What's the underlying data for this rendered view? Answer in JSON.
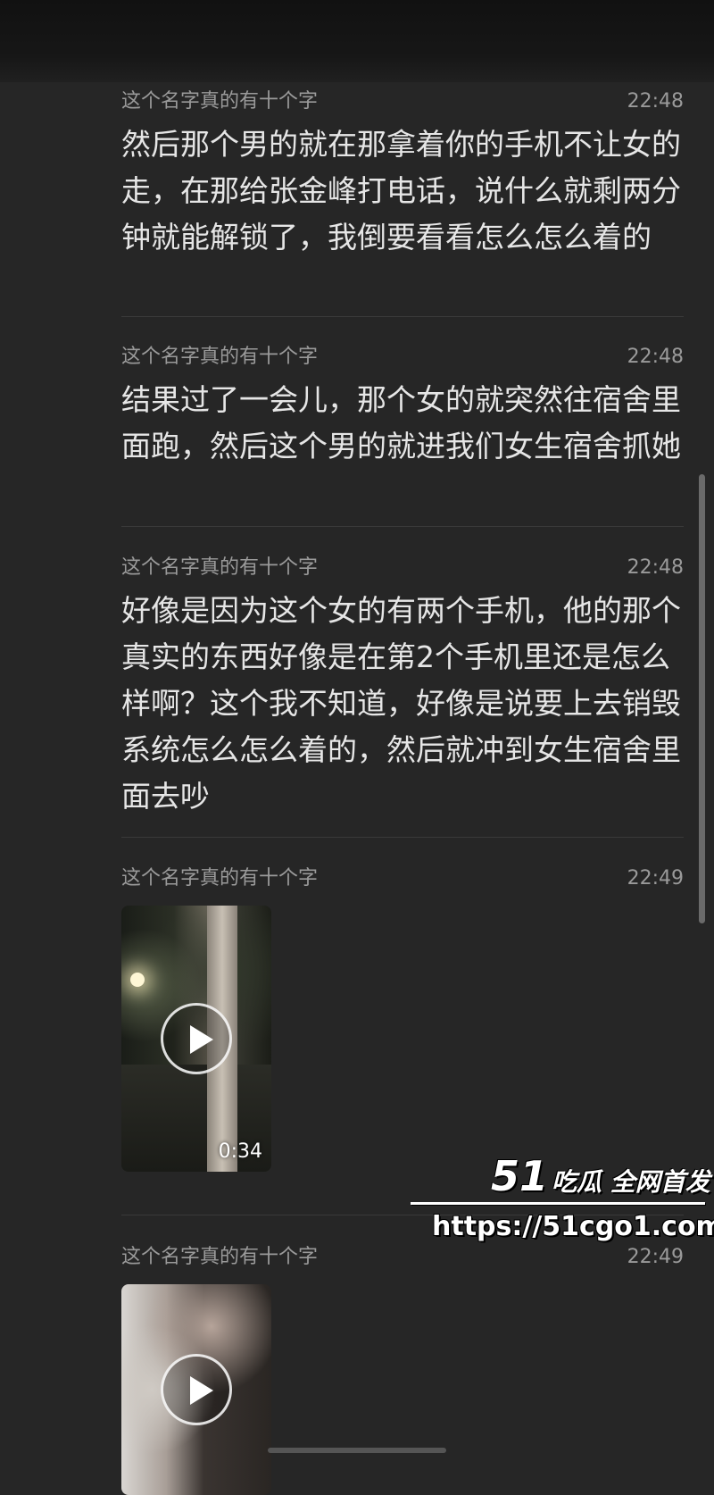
{
  "messages": [
    {
      "sender": "这个名字真的有十个字",
      "time": "22:48",
      "text": "然后那个男的就在那拿着你的手机不让女的走，在那给张金峰打电话，说什么就剩两分钟就能解锁了，我倒要看看怎么怎么着的"
    },
    {
      "sender": "这个名字真的有十个字",
      "time": "22:48",
      "text": "结果过了一会儿，那个女的就突然往宿舍里面跑，然后这个男的就进我们女生宿舍抓她"
    },
    {
      "sender": "这个名字真的有十个字",
      "time": "22:48",
      "text": "好像是因为这个女的有两个手机，他的那个真实的东西好像是在第2个手机里还是怎么样啊？这个我不知道，好像是说要上去销毁系统怎么怎么着的，然后就冲到女生宿舍里面去吵"
    },
    {
      "sender": "这个名字真的有十个字",
      "time": "22:49",
      "video_duration": "0:34"
    },
    {
      "sender": "这个名字真的有十个字",
      "time": "22:49"
    }
  ],
  "watermark": {
    "number": "51",
    "brand": "吃瓜 全网首发",
    "url": "https://51cgo1.com"
  }
}
